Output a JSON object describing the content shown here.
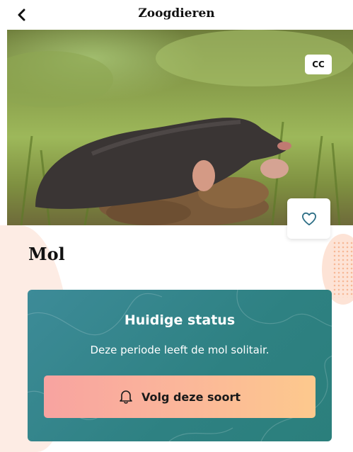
{
  "header": {
    "title": "Zoogdieren",
    "back_icon": "chevron-left-icon"
  },
  "hero": {
    "license_badge": "CC",
    "favorite_icon": "heart-icon"
  },
  "species": {
    "name": "Mol"
  },
  "status_card": {
    "title": "Huidige status",
    "description": "Deze periode leeft de mol solitair.",
    "follow_button_label": "Volg deze soort",
    "follow_icon": "bell-icon"
  },
  "colors": {
    "card_teal": "#2e8182",
    "button_gradient_start": "#f8a3a0",
    "button_gradient_end": "#fdc98d",
    "accent_peach": "#fdece4"
  }
}
